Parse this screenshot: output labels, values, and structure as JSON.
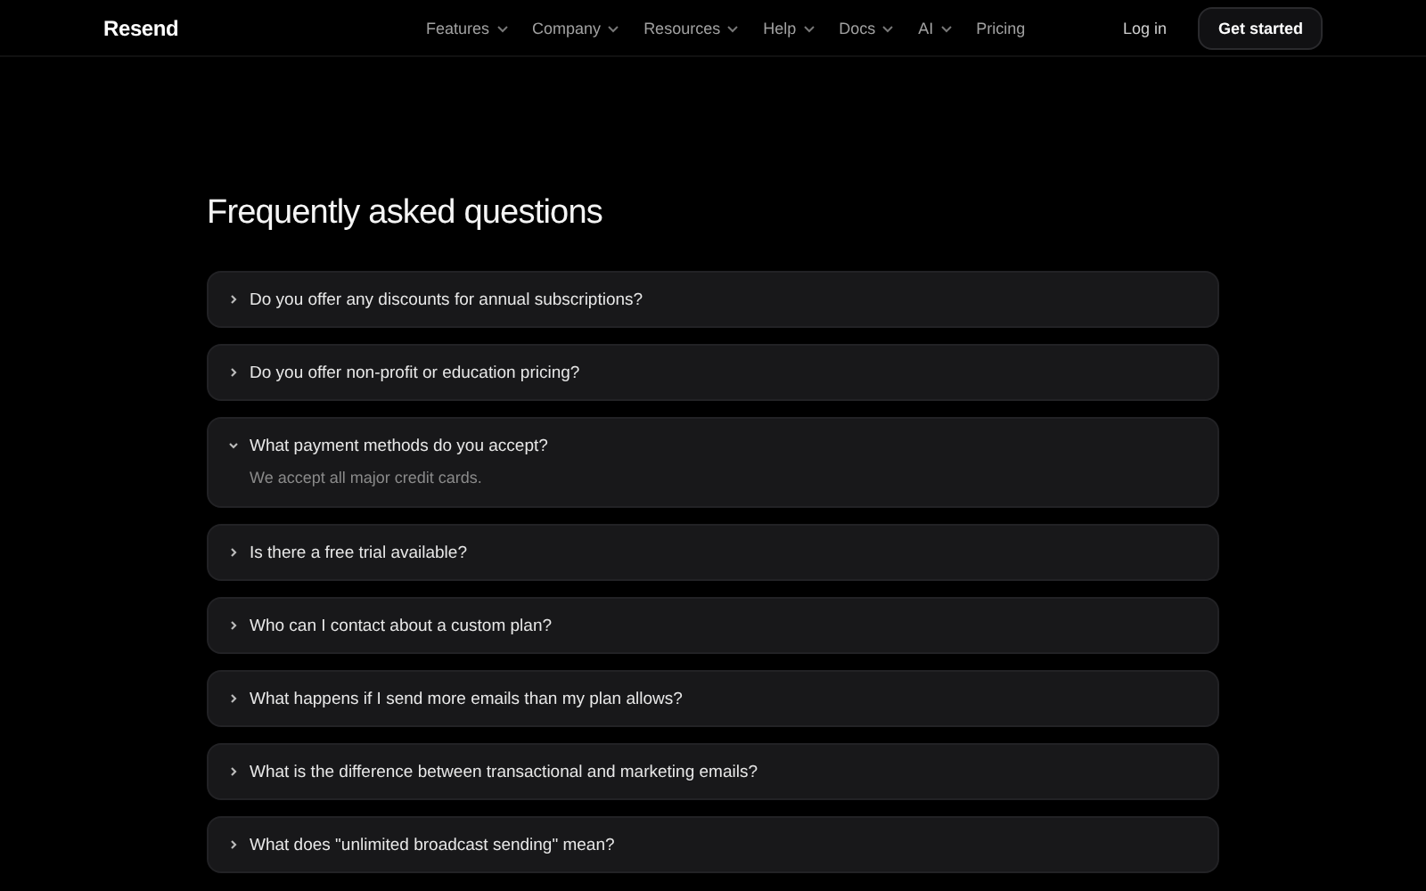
{
  "header": {
    "logo": "Resend",
    "nav": [
      {
        "label": "Features",
        "has_menu": true
      },
      {
        "label": "Company",
        "has_menu": true
      },
      {
        "label": "Resources",
        "has_menu": true
      },
      {
        "label": "Help",
        "has_menu": true
      },
      {
        "label": "Docs",
        "has_menu": true
      },
      {
        "label": "AI",
        "has_menu": true
      },
      {
        "label": "Pricing",
        "has_menu": false
      }
    ],
    "login": "Log in",
    "cta": "Get started"
  },
  "faq": {
    "title": "Frequently asked questions",
    "items": [
      {
        "question": "Do you offer any discounts for annual subscriptions?",
        "expanded": false
      },
      {
        "question": "Do you offer non-profit or education pricing?",
        "expanded": false
      },
      {
        "question": "What payment methods do you accept?",
        "expanded": true,
        "answer": "We accept all major credit cards."
      },
      {
        "question": "Is there a free trial available?",
        "expanded": false
      },
      {
        "question": "Who can I contact about a custom plan?",
        "expanded": false
      },
      {
        "question": "What happens if I send more emails than my plan allows?",
        "expanded": false
      },
      {
        "question": "What is the difference between transactional and marketing emails?",
        "expanded": false
      },
      {
        "question": "What does \"unlimited broadcast sending\" mean?",
        "expanded": false
      }
    ]
  }
}
